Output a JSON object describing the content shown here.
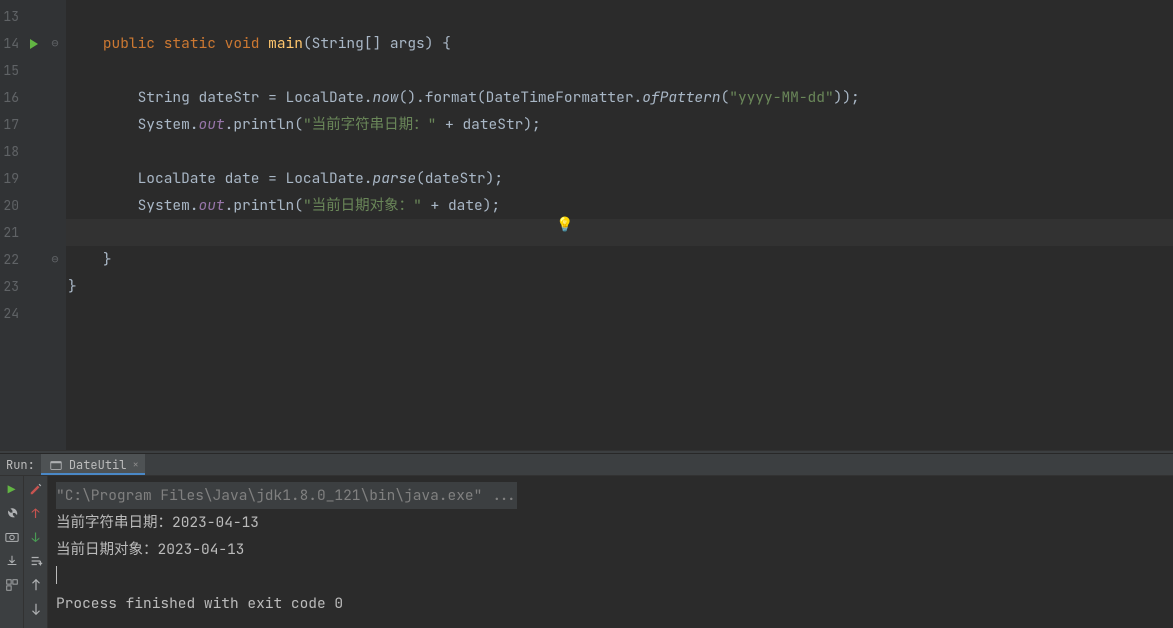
{
  "lines": {
    "13": "13",
    "14": "14",
    "15": "15",
    "16": "16",
    "17": "17",
    "18": "18",
    "19": "19",
    "20": "20",
    "21": "21",
    "22": "22",
    "23": "23",
    "24": "24"
  },
  "code": {
    "l14": {
      "indent": "    ",
      "kw1": "public ",
      "kw2": "static ",
      "kw3": "void ",
      "method": "main",
      "rest": "(String[] args) {"
    },
    "l16": {
      "indent": "        ",
      "t1": "String dateStr = LocalDate.",
      "now": "now",
      "t2": "().format(DateTimeFormatter.",
      "ofp": "ofPattern",
      "t3": "(",
      "s1": "\"yyyy-MM-dd\"",
      "t4": "));"
    },
    "l17": {
      "indent": "        ",
      "t1": "System.",
      "out": "out",
      "t2": ".println(",
      "s1": "\"当前字符串日期：\"",
      "t3": " + dateStr);"
    },
    "l19": {
      "indent": "        ",
      "t1": "LocalDate date = LocalDate.",
      "parse": "parse",
      "t2": "(dateStr);"
    },
    "l20": {
      "indent": "        ",
      "t1": "System.",
      "out": "out",
      "t2": ".println(",
      "s1": "\"当前日期对象：\"",
      "t3": " + date);"
    },
    "l22": {
      "indent": "    ",
      "t1": "}"
    },
    "l23": {
      "indent": "",
      "t1": "}"
    }
  },
  "run": {
    "label": "Run:",
    "tab_name": "DateUtil",
    "close": "×"
  },
  "console": {
    "l1": "\"C:\\Program Files\\Java\\jdk1.8.0_121\\bin\\java.exe\" ...",
    "l2": "当前字符串日期：2023-04-13",
    "l3": "当前日期对象：2023-04-13",
    "l5": "Process finished with exit code 0"
  }
}
